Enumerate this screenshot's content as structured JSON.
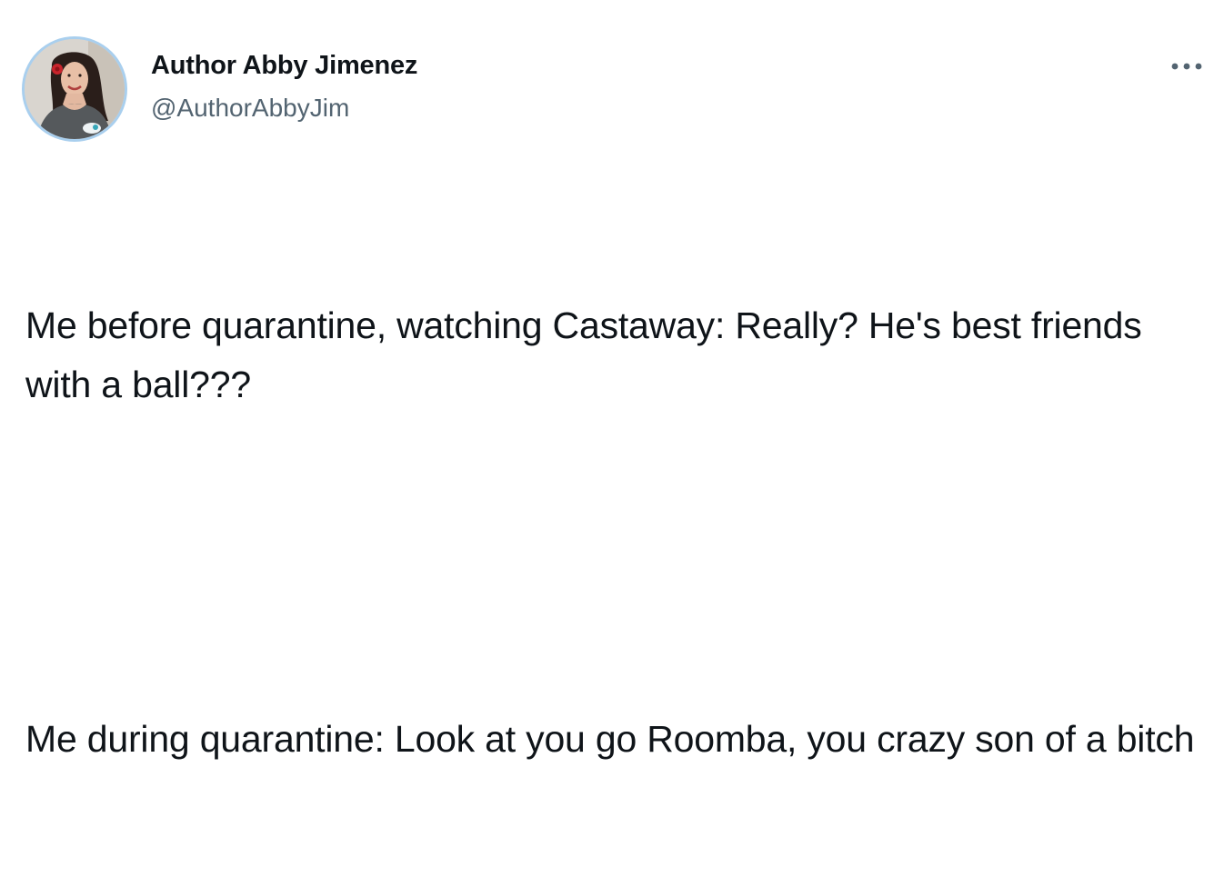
{
  "tweet": {
    "author": {
      "display_name": "Author Abby Jimenez",
      "handle": "@AuthorAbbyJim",
      "avatar_icon": "profile-photo",
      "avatar_ring_color": "#a9cfee"
    },
    "more_icon": "more-options-icon",
    "paragraphs": [
      "Me before quarantine, watching Castaway: Really? He's best friends with a ball???",
      "Me during quarantine: Look at you go Roomba, you crazy son of a bitch"
    ]
  },
  "colors": {
    "text_primary": "#0f1419",
    "text_secondary": "#536471",
    "background": "#ffffff"
  }
}
